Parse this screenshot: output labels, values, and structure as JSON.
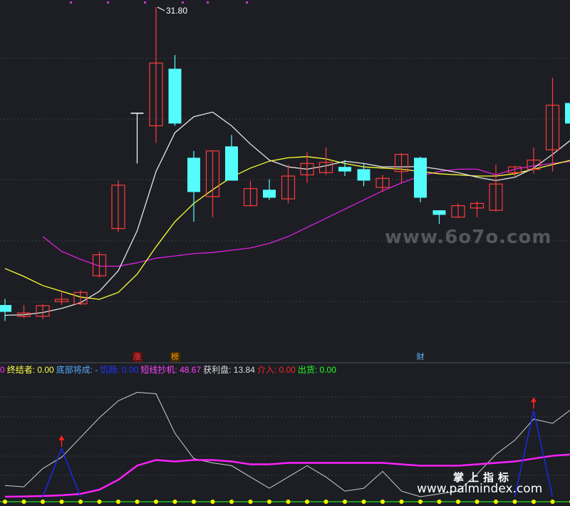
{
  "chart_data": {
    "type": "candlestick",
    "price_labels": {
      "high": "31.80"
    },
    "candles": [
      {
        "o": 18.75,
        "c": 18.45,
        "h": 19.02,
        "l": 18.05
      },
      {
        "o": 18.25,
        "c": 18.4,
        "h": 18.75,
        "l": 18.18
      },
      {
        "o": 18.26,
        "c": 18.72,
        "h": 18.78,
        "l": 18.12
      },
      {
        "o": 18.9,
        "c": 19.0,
        "h": 19.35,
        "l": 18.75
      },
      {
        "o": 18.8,
        "c": 19.3,
        "h": 19.4,
        "l": 18.75
      },
      {
        "o": 20.03,
        "c": 20.95,
        "h": 21.1,
        "l": 19.95
      },
      {
        "o": 22.1,
        "c": 24.0,
        "h": 24.2,
        "l": 21.95
      },
      {
        "o": 27.15,
        "c": 27.15,
        "h": 27.15,
        "l": 24.95
      },
      {
        "o": 26.6,
        "c": 29.35,
        "h": 31.8,
        "l": 25.85
      },
      {
        "o": 29.1,
        "c": 26.7,
        "h": 29.7,
        "l": 26.6
      },
      {
        "o": 25.2,
        "c": 23.7,
        "h": 25.5,
        "l": 22.4
      },
      {
        "o": 23.5,
        "c": 25.5,
        "h": 25.5,
        "l": 22.6
      },
      {
        "o": 25.7,
        "c": 24.2,
        "h": 26.2,
        "l": 24.2
      },
      {
        "o": 23.1,
        "c": 23.85,
        "h": 24.2,
        "l": 23.1
      },
      {
        "o": 23.8,
        "c": 23.45,
        "h": 24.25,
        "l": 23.35
      },
      {
        "o": 23.4,
        "c": 24.4,
        "h": 24.9,
        "l": 23.2
      },
      {
        "o": 24.45,
        "c": 24.95,
        "h": 25.45,
        "l": 24.1
      },
      {
        "o": 24.55,
        "c": 25.0,
        "h": 25.65,
        "l": 24.45
      },
      {
        "o": 24.8,
        "c": 24.6,
        "h": 25.1,
        "l": 24.4
      },
      {
        "o": 24.7,
        "c": 24.2,
        "h": 24.95,
        "l": 23.95
      },
      {
        "o": 23.9,
        "c": 24.3,
        "h": 24.45,
        "l": 23.7
      },
      {
        "o": 24.6,
        "c": 25.35,
        "h": 25.4,
        "l": 24.1
      },
      {
        "o": 25.2,
        "c": 23.45,
        "h": 25.25,
        "l": 23.25
      },
      {
        "o": 22.9,
        "c": 22.7,
        "h": 22.9,
        "l": 22.3
      },
      {
        "o": 22.6,
        "c": 23.1,
        "h": 23.2,
        "l": 22.6
      },
      {
        "o": 23.0,
        "c": 23.2,
        "h": 23.3,
        "l": 22.6
      },
      {
        "o": 22.9,
        "c": 24.05,
        "h": 24.9,
        "l": 22.85
      },
      {
        "o": 24.55,
        "c": 24.8,
        "h": 24.85,
        "l": 24.4
      },
      {
        "o": 24.7,
        "c": 25.1,
        "h": 25.65,
        "l": 24.5
      },
      {
        "o": 25.55,
        "c": 27.5,
        "h": 28.7,
        "l": 24.6
      },
      {
        "o": 27.6,
        "c": 26.7,
        "h": 30.5,
        "l": 26.7
      }
    ],
    "ma_white": [
      18.3,
      18.32,
      18.42,
      18.6,
      18.85,
      19.35,
      20.25,
      22.0,
      24.6,
      26.3,
      27.0,
      27.2,
      26.6,
      25.8,
      25.1,
      24.8,
      24.7,
      24.85,
      25.05,
      24.95,
      24.8,
      24.8,
      24.82,
      24.7,
      24.55,
      24.35,
      24.2,
      24.35,
      24.75,
      25.35,
      26.0
    ],
    "ma_yellow": [
      20.35,
      20.0,
      19.6,
      19.35,
      19.1,
      19.0,
      19.3,
      20.1,
      21.3,
      22.4,
      23.2,
      23.8,
      24.35,
      24.75,
      25.05,
      25.2,
      25.25,
      25.15,
      24.95,
      24.8,
      24.75,
      24.7,
      24.6,
      24.5,
      24.45,
      24.4,
      24.4,
      24.5,
      24.7,
      24.9,
      25.1
    ],
    "ma_magenta": [
      null,
      null,
      21.75,
      21.1,
      20.75,
      20.45,
      20.45,
      20.6,
      20.8,
      20.9,
      21.0,
      21.05,
      21.15,
      21.25,
      21.45,
      21.75,
      22.15,
      22.55,
      22.95,
      23.35,
      23.75,
      24.1,
      24.4,
      24.6,
      24.7,
      24.7,
      24.45,
      24.7,
      24.85,
      24.95,
      25.05
    ],
    "osc_white": [
      8,
      7,
      20,
      28,
      42,
      56,
      68,
      74,
      73,
      45,
      27,
      24,
      22,
      14,
      6,
      14,
      22,
      14,
      4,
      6,
      18,
      4,
      0,
      2,
      4,
      16,
      30,
      40,
      55,
      52,
      62
    ],
    "osc_magenta": [
      0,
      0.2,
      0.5,
      1,
      2,
      5,
      12,
      22,
      26,
      25,
      26,
      26,
      25,
      23,
      23,
      24,
      24,
      24,
      24,
      24,
      24,
      23,
      22,
      22,
      22,
      23,
      24,
      25,
      27,
      29,
      30
    ],
    "osc_blue_peaks": [
      3,
      28
    ],
    "indicator_legend": [
      {
        "text": "0",
        "color": "#ff33ff"
      },
      {
        "text": "终结者: 0.00",
        "color": "#ffff44"
      },
      {
        "text": "底部将成: -",
        "color": "#55aaff"
      },
      {
        "text": "饥肠: 0.00",
        "color": "#2233ff"
      },
      {
        "text": "短线抄机: 48.67",
        "color": "#ff44ff"
      },
      {
        "text": "获利盘: 13.84",
        "color": "#dddddd"
      },
      {
        "text": "介入: 0.00",
        "color": "#ff2222"
      },
      {
        "text": "出货: 0.00",
        "color": "#22ff22"
      }
    ],
    "markers": [
      {
        "text": "涨",
        "color": "#ff4444",
        "bg": "#5a1010",
        "index": 7
      },
      {
        "text": "榜",
        "color": "#ff9900",
        "bg": "#3a2a05",
        "index": 9
      },
      {
        "text": "财",
        "color": "#66bbff",
        "bg": "transparent",
        "index": 22
      }
    ],
    "colors": {
      "up": "#ff3b3b",
      "down": "#54fcfc",
      "ma_white": "#e6e6e6",
      "ma_yellow": "#ffff33",
      "ma_magenta": "#e020e0",
      "osc_white": "#cfcfcf",
      "osc_magenta": "#ff22ff",
      "osc_blue": "#1a2cff",
      "arrow": "#ff2020",
      "dot": "#ffff00",
      "baseline": "#22dd22",
      "grid": "#3a3d45"
    }
  },
  "watermarks": {
    "site_6070": "www.6o7o.com",
    "brand": "掌上指标",
    "site_palm": "www.palmindex.com"
  }
}
